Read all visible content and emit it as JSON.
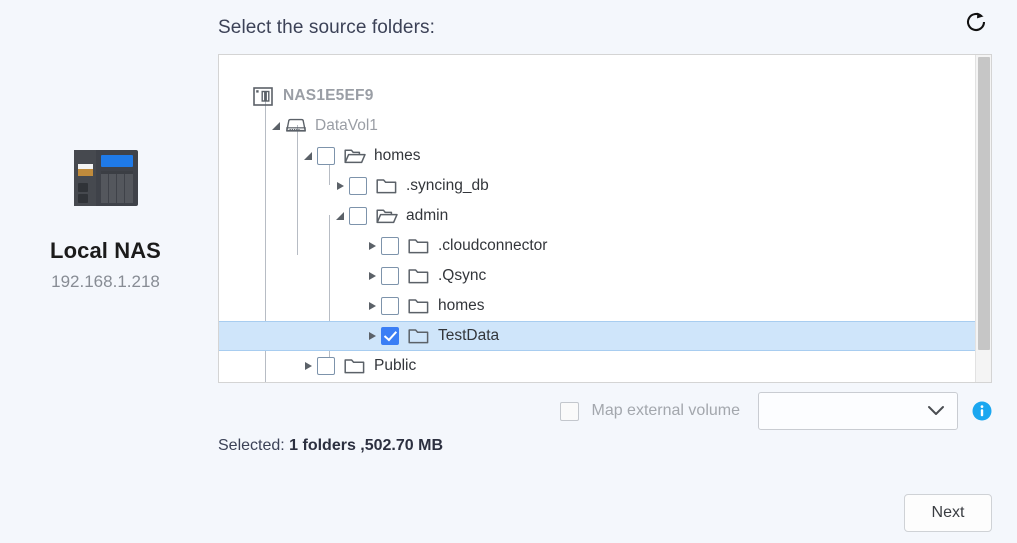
{
  "device": {
    "name": "Local NAS",
    "ip": "192.168.1.218",
    "icon": "nas-device-icon"
  },
  "header": {
    "title": "Select the source folders:",
    "refresh_icon": "refresh-icon"
  },
  "tree": {
    "nodes": [
      {
        "id": "nas",
        "label": "NAS1E5EF9",
        "depth": 0,
        "twisty": "none",
        "checkbox": "none",
        "icon": "nas-icon",
        "style": "root"
      },
      {
        "id": "datavol1",
        "label": "DataVol1",
        "depth": 1,
        "twisty": "expanded",
        "checkbox": "none",
        "icon": "volume-icon",
        "style": "volume"
      },
      {
        "id": "homes",
        "label": "homes",
        "depth": 2,
        "twisty": "expanded",
        "checkbox": "unchecked",
        "icon": "folder-open-icon",
        "style": "normal"
      },
      {
        "id": "syncing_db",
        "label": ".syncing_db",
        "depth": 3,
        "twisty": "collapsed",
        "checkbox": "unchecked",
        "icon": "folder-icon",
        "style": "normal"
      },
      {
        "id": "admin",
        "label": "admin",
        "depth": 3,
        "twisty": "expanded",
        "checkbox": "unchecked",
        "icon": "folder-open-icon",
        "style": "normal"
      },
      {
        "id": "cloudconnector",
        "label": ".cloudconnector",
        "depth": 4,
        "twisty": "collapsed",
        "checkbox": "unchecked",
        "icon": "folder-icon",
        "style": "normal"
      },
      {
        "id": "qsync",
        "label": ".Qsync",
        "depth": 4,
        "twisty": "collapsed",
        "checkbox": "unchecked",
        "icon": "folder-icon",
        "style": "normal"
      },
      {
        "id": "homes2",
        "label": "homes",
        "depth": 4,
        "twisty": "collapsed",
        "checkbox": "unchecked",
        "icon": "folder-icon",
        "style": "normal"
      },
      {
        "id": "testdata",
        "label": "TestData",
        "depth": 4,
        "twisty": "collapsed",
        "checkbox": "checked",
        "icon": "folder-icon",
        "style": "selected"
      },
      {
        "id": "public",
        "label": "Public",
        "depth": 2,
        "twisty": "collapsed",
        "checkbox": "unchecked",
        "icon": "folder-icon",
        "style": "normal"
      }
    ],
    "scrollbar": {
      "name": "tree-vertical-scrollbar"
    }
  },
  "map_volume": {
    "checkbox_checked": false,
    "label": "Map external volume",
    "select_value": "",
    "chevron_icon": "chevron-down-icon",
    "info_icon": "info-icon"
  },
  "summary": {
    "prefix": "Selected: ",
    "value": "1 folders ,502.70 MB"
  },
  "footer": {
    "next_label": "Next"
  },
  "colors": {
    "page_bg": "#f4f7fc",
    "selected_row": "#cfe5fa",
    "checkbox_blue": "#3b7ef5",
    "info_blue": "#1ba7f0",
    "muted_text": "#9a9ea5"
  }
}
